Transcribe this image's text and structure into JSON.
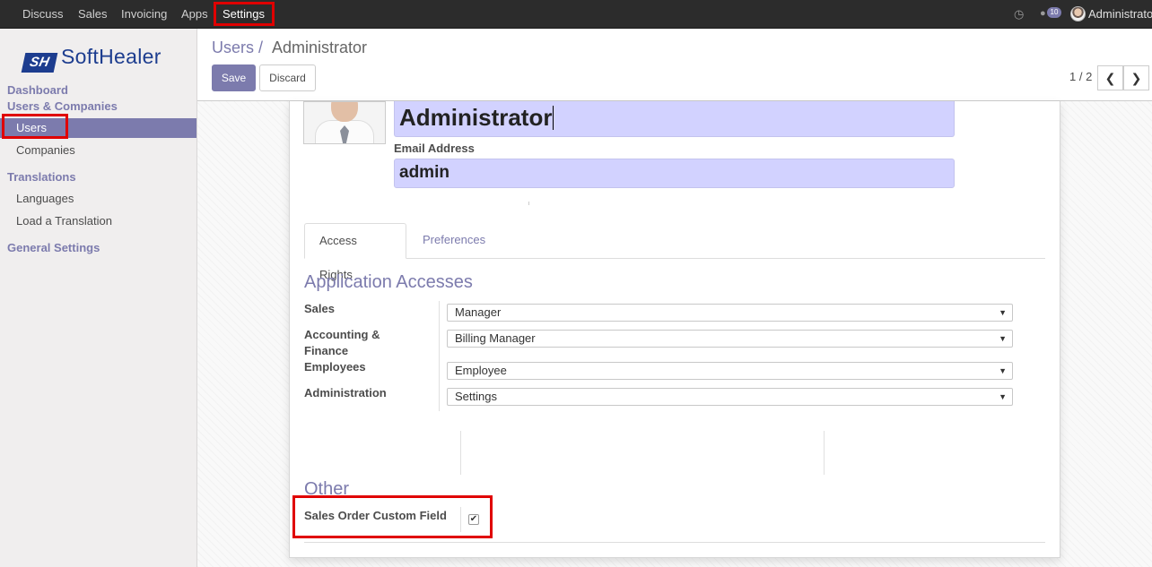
{
  "topbar": {
    "menu": [
      "Discuss",
      "Sales",
      "Invoicing",
      "Apps",
      "Settings"
    ],
    "chat_count": "10",
    "user_name": "Administrator"
  },
  "sidebar": {
    "logo_mark": "SH",
    "logo_text": "SoftHealer",
    "dashboard": "Dashboard",
    "users_companies": "Users & Companies",
    "users": "Users",
    "companies": "Companies",
    "translations": "Translations",
    "languages": "Languages",
    "load_translation": "Load a Translation",
    "general_settings": "General Settings"
  },
  "control": {
    "breadcrumb_parent": "Users /",
    "breadcrumb_current": "Administrator",
    "save": "Save",
    "discard": "Discard",
    "pager": "1 / 2"
  },
  "form": {
    "name": "Administrator",
    "email_label": "Email Address",
    "email": "admin",
    "tabs": [
      "Access Rights",
      "Preferences"
    ],
    "app_accesses_title": "Application Accesses",
    "rows": [
      {
        "label": "Sales",
        "value": "Manager"
      },
      {
        "label": "Accounting & Finance",
        "value": "Billing Manager"
      },
      {
        "label": "Employees",
        "value": "Employee"
      },
      {
        "label": "Administration",
        "value": "Settings"
      }
    ],
    "other_title": "Other",
    "custom_field_label": "Sales Order Custom Field",
    "custom_field_checked": true
  },
  "colors": {
    "accent": "#7c7bad",
    "topbar": "#2c2c2c",
    "highlight": "#e00000",
    "input_bg": "#d2d2ff"
  }
}
